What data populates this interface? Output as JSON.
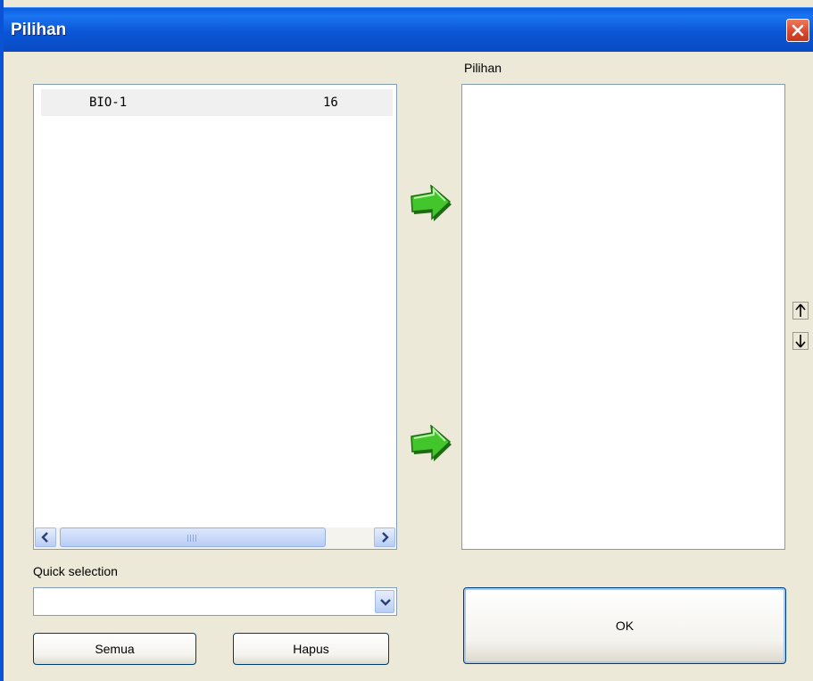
{
  "window": {
    "title": "Pilihan"
  },
  "source_list": {
    "rows": [
      {
        "name": "BIO-1",
        "value": "16"
      }
    ]
  },
  "selected_list": {
    "label": "Pilihan"
  },
  "quick_selection": {
    "label": "Quick selection",
    "value": ""
  },
  "buttons": {
    "all": "Semua",
    "delete": "Hapus",
    "ok": "OK"
  },
  "icons": {
    "close": "close-icon",
    "add_arrow": "green-right-arrow-icon",
    "move_up": "arrow-up-icon",
    "move_down": "arrow-down-icon",
    "dropdown": "chevron-down-icon"
  },
  "colors": {
    "titlebar": "#0a56d6",
    "arrow_green": "#3fbf2a",
    "close_red": "#d9452a"
  }
}
